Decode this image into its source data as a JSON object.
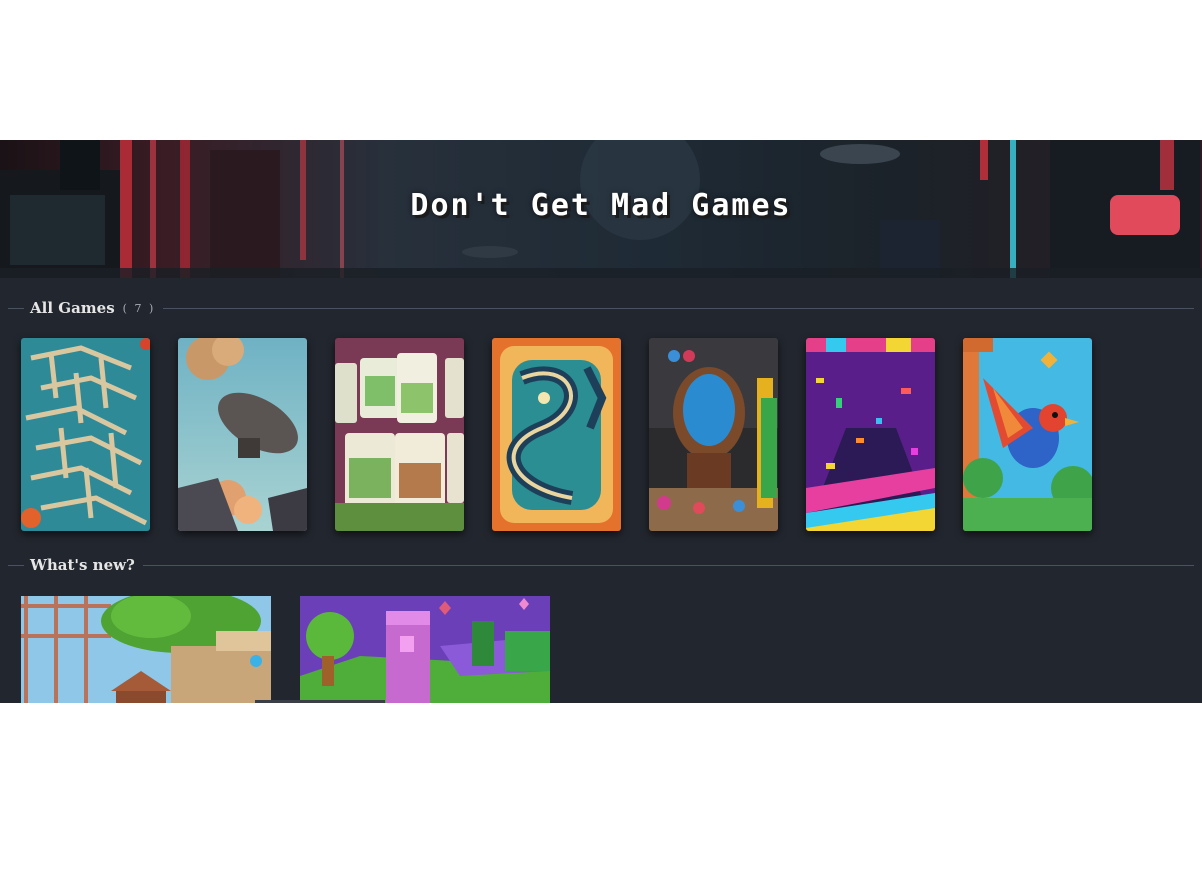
{
  "banner": {
    "title": "Don't Get Mad Games"
  },
  "sections": {
    "all_games": {
      "label": "All Games",
      "count": "( 7 )"
    },
    "whats_new": {
      "label": "What's new?"
    }
  },
  "games": [
    {
      "thumbnail": "maze-thumbnail"
    },
    {
      "thumbnail": "airship-thumbnail"
    },
    {
      "thumbnail": "cards-thumbnail"
    },
    {
      "thumbnail": "snake-thumbnail"
    },
    {
      "thumbnail": "egg-thumbnail"
    },
    {
      "thumbnail": "confetti-thumbnail"
    },
    {
      "thumbnail": "bird-thumbnail"
    }
  ],
  "news": [
    {
      "thumbnail": "treehouse-thumbnail"
    },
    {
      "thumbnail": "voxel-tower-thumbnail"
    }
  ],
  "colors": {
    "background": "#22262e",
    "divider": "#4a5160",
    "heading_text": "#e6e6e6"
  }
}
